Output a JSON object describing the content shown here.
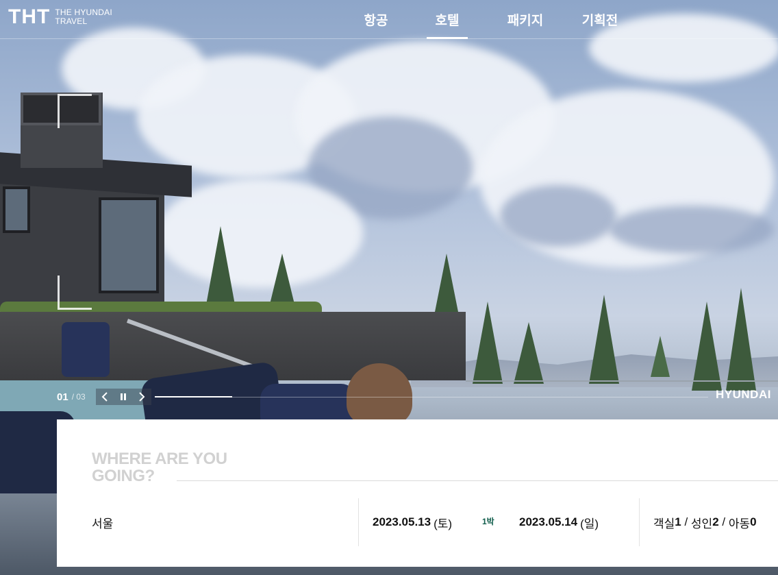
{
  "header": {
    "logo": {
      "mark": "THT",
      "line1": "THE HYUNDAI",
      "line2": "TRAVEL"
    },
    "nav": [
      {
        "label": "항공",
        "active": false
      },
      {
        "label": "호텔",
        "active": true
      },
      {
        "label": "패키지",
        "active": false
      },
      {
        "label": "기획전",
        "active": false
      }
    ]
  },
  "slider": {
    "current": "01",
    "total": "/ 03",
    "progress": 0.14,
    "prev_icon": "chevron-left-icon",
    "pause_icon": "pause-icon",
    "next_icon": "chevron-right-icon",
    "brand_label": "HYUNDAI"
  },
  "search": {
    "title_line1": "WHERE ARE YOU",
    "title_line2": "GOING?",
    "destination": "서울",
    "checkin": {
      "date": "2023.05.13",
      "day": "(토)"
    },
    "nights": "1박",
    "checkout": {
      "date": "2023.05.14",
      "day": "(일)"
    },
    "guests": {
      "rooms_label": "객실",
      "rooms": "1",
      "adults_label": "성인",
      "adults": "2",
      "children_label": "아동",
      "children": "0",
      "sep": " / "
    }
  },
  "colors": {
    "nights_text": "#0f5c4a",
    "title_text": "#d1d1d1",
    "panel_bg": "#ffffff"
  }
}
